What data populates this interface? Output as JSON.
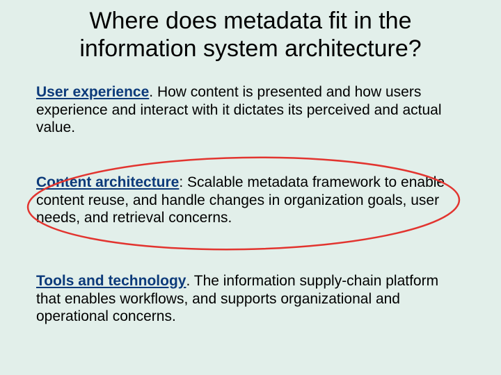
{
  "title": "Where does metadata fit in the information system architecture?",
  "sections": [
    {
      "lead": "User experience",
      "sep": ". ",
      "body": "How content is presented and how users experience and interact with it dictates its perceived and actual value."
    },
    {
      "lead": "Content architecture",
      "sep": ": ",
      "body": "Scalable metadata framework to enable content reuse, and handle changes in organization goals, user needs, and retrieval concerns."
    },
    {
      "lead": "Tools and technology",
      "sep": ". ",
      "body": "The information supply-chain platform that enables workflows, and supports organizational and operational concerns."
    }
  ],
  "highlighted_section_index": 1,
  "colors": {
    "background": "#e2efea",
    "lead_text": "#0c3a7a",
    "ellipse_stroke": "#e2342f"
  }
}
